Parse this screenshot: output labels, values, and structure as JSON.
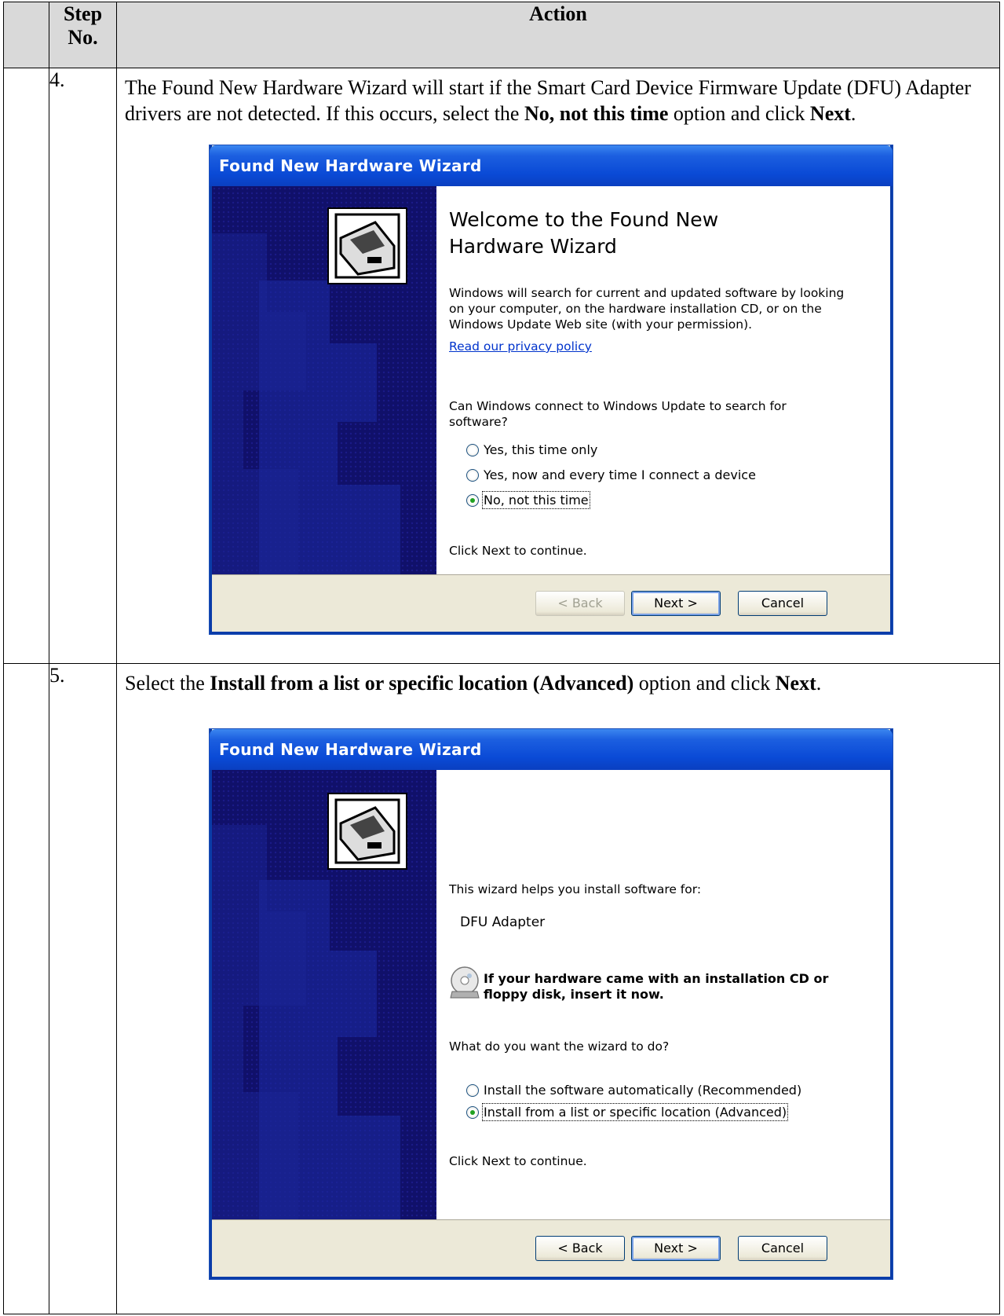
{
  "table": {
    "header_step": "Step No.",
    "header_action": "Action"
  },
  "steps": [
    {
      "number": "4.",
      "text_parts": [
        {
          "t": "The Found New Hardware Wizard will start if the Smart Card Device Firmware Update (DFU) Adapter drivers are not detected.  If this occurs, select the ",
          "b": false
        },
        {
          "t": "No, not this time",
          "b": true
        },
        {
          "t": " option and click ",
          "b": false
        },
        {
          "t": "Next",
          "b": true
        },
        {
          "t": ".",
          "b": false
        }
      ],
      "dialog": {
        "title": "Found New Hardware Wizard",
        "welcome_title": "Welcome to the Found New Hardware Wizard",
        "intro": "Windows will search for current and updated software by looking on your computer, on the hardware installation CD, or on the Windows Update Web site (with your permission).",
        "privacy_link": "Read our privacy policy",
        "question": "Can Windows connect to Windows Update to search for software?",
        "options": [
          {
            "label": "Yes, this time only",
            "selected": false
          },
          {
            "label": "Yes, now and every time I connect a device",
            "selected": false
          },
          {
            "label": "No, not this time",
            "selected": true
          }
        ],
        "continue": "Click Next to continue.",
        "buttons": {
          "back": "< Back",
          "back_enabled": false,
          "next": "Next >",
          "cancel": "Cancel"
        }
      }
    },
    {
      "number": "5.",
      "text_parts": [
        {
          "t": "Select the ",
          "b": false
        },
        {
          "t": "Install from a list or specific location (Advanced)",
          "b": true
        },
        {
          "t": " option and click ",
          "b": false
        },
        {
          "t": "Next",
          "b": true
        },
        {
          "t": ".",
          "b": false
        }
      ],
      "dialog": {
        "title": "Found New Hardware Wizard",
        "intro": "This wizard helps you install software for:",
        "device": "DFU Adapter",
        "cd_note": "If your hardware came with an installation CD or floppy disk, insert it now.",
        "question": "What do you want the wizard to do?",
        "options": [
          {
            "label": "Install the software automatically (Recommended)",
            "selected": false
          },
          {
            "label": "Install from a list or specific location (Advanced)",
            "selected": true
          }
        ],
        "continue": "Click Next to continue.",
        "buttons": {
          "back": "< Back",
          "back_enabled": true,
          "next": "Next >",
          "cancel": "Cancel"
        }
      }
    }
  ],
  "colors": {
    "title_bar": "#0a4ad6",
    "left_pane": "#11116a",
    "header_fill": "#d9d9d9",
    "radio_dot": "#21a121"
  }
}
